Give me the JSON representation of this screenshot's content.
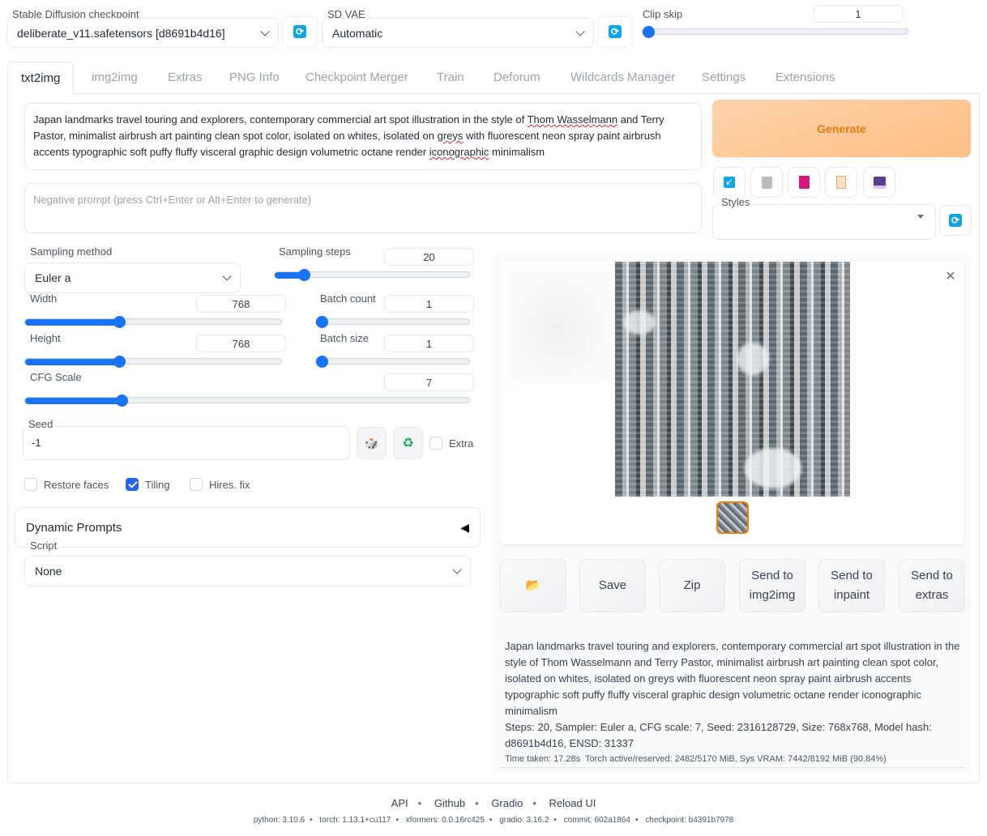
{
  "top": {
    "checkpoint_label": "Stable Diffusion checkpoint",
    "checkpoint_value": "deliberate_v11.safetensors [d8691b4d16]",
    "vae_label": "SD VAE",
    "vae_value": "Automatic",
    "clip_skip_label": "Clip skip",
    "clip_skip_value": "1"
  },
  "tabs": [
    "txt2img",
    "img2img",
    "Extras",
    "PNG Info",
    "Checkpoint Merger",
    "Train",
    "Deforum",
    "Wildcards Manager",
    "Settings",
    "Extensions"
  ],
  "prompt": {
    "parts": [
      "Japan landmarks travel touring and explorers, contemporary commercial art spot illustration in the style of ",
      "Thom Wasselmann",
      " and Terry Pastor, minimalist airbrush art painting clean spot color, isolated on whites, isolated on ",
      "greys",
      " with fluorescent neon spray paint airbrush accents typographic soft puffy fluffy visceral graphic design volumetric octane render ",
      "iconographic",
      " minimalism"
    ],
    "negative_placeholder": "Negative prompt (press Ctrl+Enter or Alt+Enter to generate)"
  },
  "generate": {
    "label": "Generate"
  },
  "tools": [
    "paste-arrow",
    "trash",
    "image-picture",
    "clipboard",
    "floppy-disk"
  ],
  "styles": {
    "label": "Styles",
    "value": ""
  },
  "params": {
    "sampling_method_label": "Sampling method",
    "sampling_method_value": "Euler a",
    "sampling_steps_label": "Sampling steps",
    "sampling_steps_value": "20",
    "width_label": "Width",
    "width_value": "768",
    "height_label": "Height",
    "height_value": "768",
    "batch_count_label": "Batch count",
    "batch_count_value": "1",
    "batch_size_label": "Batch size",
    "batch_size_value": "1",
    "cfg_label": "CFG Scale",
    "cfg_value": "7",
    "seed_label": "Seed",
    "seed_value": "-1",
    "extra_label": "Extra",
    "restore_faces_label": "Restore faces",
    "tiling_label": "Tiling",
    "hires_label": "Hires. fix",
    "restore_faces_checked": false,
    "tiling_checked": true,
    "hires_checked": false,
    "extra_checked": false
  },
  "dynamic_prompts": {
    "label": "Dynamic Prompts",
    "arrow": "◀"
  },
  "script": {
    "label": "Script",
    "value": "None"
  },
  "output_buttons": {
    "folder": "📂",
    "save": "Save",
    "zip": "Zip",
    "send_img2img": [
      "Send to",
      "img2img"
    ],
    "send_inpaint": [
      "Send to",
      "inpaint"
    ],
    "send_extras": [
      "Send to",
      "extras"
    ]
  },
  "info": {
    "prompt": "Japan landmarks travel touring and explorers, contemporary commercial art spot illustration in the style of Thom Wasselmann and Terry Pastor, minimalist airbrush art painting clean spot color, isolated on whites, isolated on greys with fluorescent neon spray paint airbrush accents typographic soft puffy fluffy visceral graphic design volumetric octane render iconographic minimalism",
    "params": "Steps: 20, Sampler: Euler a, CFG scale: 7, Seed: 2316128729, Size: 768x768, Model hash: d8691b4d16, ENSD: 31337",
    "timing": "Time taken: 17.28s  Torch active/reserved: 2482/5170 MiB, Sys VRAM: 7442/8192 MiB (90.84%)"
  },
  "footer": {
    "links": [
      "API",
      "Github",
      "Gradio",
      "Reload UI"
    ],
    "versions": [
      "python: 3.10.6",
      "torch: 1.13.1+cu117",
      "xformers: 0.0.16rc425",
      "gradio: 3.16.2",
      "commit: 602a1864",
      "checkpoint: b4391b7978"
    ]
  },
  "sliders": {
    "clip_skip_fraction": 0.0,
    "sampling_steps_fraction": 0.13,
    "width_fraction": 0.36,
    "height_fraction": 0.36,
    "batch_count_fraction": 0.0,
    "batch_size_fraction": 0.0,
    "cfg_fraction": 0.21
  },
  "colors": {
    "accent": "#1a73f5",
    "generate_bg": "#fdc089",
    "generate_text": "#ea7a14",
    "thumb_border": "#f07c0a"
  }
}
